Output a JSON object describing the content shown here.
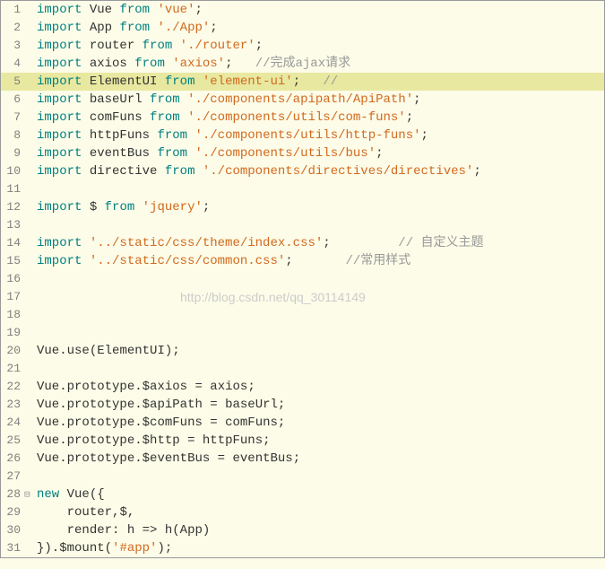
{
  "watermark": "http://blog.csdn.net/qq_30114149",
  "lines": [
    {
      "num": "1",
      "tokens": [
        [
          "kw",
          "import"
        ],
        [
          "",
          " "
        ],
        [
          "id",
          "Vue"
        ],
        [
          "",
          " "
        ],
        [
          "kw",
          "from"
        ],
        [
          "",
          " "
        ],
        [
          "str",
          "'vue'"
        ],
        [
          "",
          ";"
        ]
      ]
    },
    {
      "num": "2",
      "tokens": [
        [
          "kw",
          "import"
        ],
        [
          "",
          " "
        ],
        [
          "id",
          "App"
        ],
        [
          "",
          " "
        ],
        [
          "kw",
          "from"
        ],
        [
          "",
          " "
        ],
        [
          "str",
          "'./App'"
        ],
        [
          "",
          ";"
        ]
      ]
    },
    {
      "num": "3",
      "tokens": [
        [
          "kw",
          "import"
        ],
        [
          "",
          " "
        ],
        [
          "id",
          "router"
        ],
        [
          "",
          " "
        ],
        [
          "kw",
          "from"
        ],
        [
          "",
          " "
        ],
        [
          "str",
          "'./router'"
        ],
        [
          "",
          ";"
        ]
      ]
    },
    {
      "num": "4",
      "tokens": [
        [
          "kw",
          "import"
        ],
        [
          "",
          " "
        ],
        [
          "id",
          "axios"
        ],
        [
          "",
          " "
        ],
        [
          "kw",
          "from"
        ],
        [
          "",
          " "
        ],
        [
          "str",
          "'axios'"
        ],
        [
          "",
          ";   "
        ],
        [
          "cm",
          "//完成ajax请求"
        ]
      ]
    },
    {
      "num": "5",
      "highlighted": true,
      "tokens": [
        [
          "kw",
          "import"
        ],
        [
          "",
          " "
        ],
        [
          "id",
          "ElementUI"
        ],
        [
          "",
          " "
        ],
        [
          "kw",
          "from"
        ],
        [
          "",
          " "
        ],
        [
          "str",
          "'element-ui'"
        ],
        [
          "",
          ";   "
        ],
        [
          "cm",
          "//"
        ]
      ]
    },
    {
      "num": "6",
      "tokens": [
        [
          "kw",
          "import"
        ],
        [
          "",
          " "
        ],
        [
          "id",
          "baseUrl"
        ],
        [
          "",
          " "
        ],
        [
          "kw",
          "from"
        ],
        [
          "",
          " "
        ],
        [
          "str",
          "'./components/apipath/ApiPath'"
        ],
        [
          "",
          ";"
        ]
      ]
    },
    {
      "num": "7",
      "tokens": [
        [
          "kw",
          "import"
        ],
        [
          "",
          " "
        ],
        [
          "id",
          "comFuns"
        ],
        [
          "",
          " "
        ],
        [
          "kw",
          "from"
        ],
        [
          "",
          " "
        ],
        [
          "str",
          "'./components/utils/com-funs'"
        ],
        [
          "",
          ";"
        ]
      ]
    },
    {
      "num": "8",
      "tokens": [
        [
          "kw",
          "import"
        ],
        [
          "",
          " "
        ],
        [
          "id",
          "httpFuns"
        ],
        [
          "",
          " "
        ],
        [
          "kw",
          "from"
        ],
        [
          "",
          " "
        ],
        [
          "str",
          "'./components/utils/http-funs'"
        ],
        [
          "",
          ";"
        ]
      ]
    },
    {
      "num": "9",
      "tokens": [
        [
          "kw",
          "import"
        ],
        [
          "",
          " "
        ],
        [
          "id",
          "eventBus"
        ],
        [
          "",
          " "
        ],
        [
          "kw",
          "from"
        ],
        [
          "",
          " "
        ],
        [
          "str",
          "'./components/utils/bus'"
        ],
        [
          "",
          ";"
        ]
      ]
    },
    {
      "num": "10",
      "tokens": [
        [
          "kw",
          "import"
        ],
        [
          "",
          " "
        ],
        [
          "id",
          "directive"
        ],
        [
          "",
          " "
        ],
        [
          "kw",
          "from"
        ],
        [
          "",
          " "
        ],
        [
          "str",
          "'./components/directives/directives'"
        ],
        [
          "",
          ";"
        ]
      ]
    },
    {
      "num": "11",
      "tokens": []
    },
    {
      "num": "12",
      "tokens": [
        [
          "kw",
          "import"
        ],
        [
          "",
          " "
        ],
        [
          "id",
          "$"
        ],
        [
          "",
          " "
        ],
        [
          "kw",
          "from"
        ],
        [
          "",
          " "
        ],
        [
          "str",
          "'jquery'"
        ],
        [
          "",
          ";"
        ]
      ]
    },
    {
      "num": "13",
      "tokens": []
    },
    {
      "num": "14",
      "tokens": [
        [
          "kw",
          "import"
        ],
        [
          "",
          " "
        ],
        [
          "str",
          "'../static/css/theme/index.css'"
        ],
        [
          "",
          ";         "
        ],
        [
          "cm",
          "// 自定义主题"
        ]
      ]
    },
    {
      "num": "15",
      "tokens": [
        [
          "kw",
          "import"
        ],
        [
          "",
          " "
        ],
        [
          "str",
          "'../static/css/common.css'"
        ],
        [
          "",
          ";       "
        ],
        [
          "cm",
          "//常用样式"
        ]
      ]
    },
    {
      "num": "16",
      "tokens": []
    },
    {
      "num": "17",
      "tokens": [],
      "watermark": true
    },
    {
      "num": "18",
      "tokens": []
    },
    {
      "num": "19",
      "tokens": []
    },
    {
      "num": "20",
      "tokens": [
        [
          "id",
          "Vue"
        ],
        [
          "",
          "."
        ],
        [
          "id",
          "use"
        ],
        [
          "",
          "("
        ],
        [
          "id",
          "ElementUI"
        ],
        [
          "",
          ");"
        ]
      ]
    },
    {
      "num": "21",
      "tokens": []
    },
    {
      "num": "22",
      "tokens": [
        [
          "id",
          "Vue"
        ],
        [
          "",
          "."
        ],
        [
          "id",
          "prototype"
        ],
        [
          "",
          "."
        ],
        [
          "id",
          "$axios"
        ],
        [
          "",
          " = "
        ],
        [
          "id",
          "axios"
        ],
        [
          "",
          ";"
        ]
      ]
    },
    {
      "num": "23",
      "tokens": [
        [
          "id",
          "Vue"
        ],
        [
          "",
          "."
        ],
        [
          "id",
          "prototype"
        ],
        [
          "",
          "."
        ],
        [
          "id",
          "$apiPath"
        ],
        [
          "",
          " = "
        ],
        [
          "id",
          "baseUrl"
        ],
        [
          "",
          ";"
        ]
      ]
    },
    {
      "num": "24",
      "tokens": [
        [
          "id",
          "Vue"
        ],
        [
          "",
          "."
        ],
        [
          "id",
          "prototype"
        ],
        [
          "",
          "."
        ],
        [
          "id",
          "$comFuns"
        ],
        [
          "",
          " = "
        ],
        [
          "id",
          "comFuns"
        ],
        [
          "",
          ";"
        ]
      ]
    },
    {
      "num": "25",
      "tokens": [
        [
          "id",
          "Vue"
        ],
        [
          "",
          "."
        ],
        [
          "id",
          "prototype"
        ],
        [
          "",
          "."
        ],
        [
          "id",
          "$http"
        ],
        [
          "",
          " = "
        ],
        [
          "id",
          "httpFuns"
        ],
        [
          "",
          ";"
        ]
      ]
    },
    {
      "num": "26",
      "tokens": [
        [
          "id",
          "Vue"
        ],
        [
          "",
          "."
        ],
        [
          "id",
          "prototype"
        ],
        [
          "",
          "."
        ],
        [
          "id",
          "$eventBus"
        ],
        [
          "",
          " = "
        ],
        [
          "id",
          "eventBus"
        ],
        [
          "",
          ";"
        ]
      ]
    },
    {
      "num": "27",
      "tokens": []
    },
    {
      "num": "28",
      "fold": true,
      "tokens": [
        [
          "kw",
          "new"
        ],
        [
          "",
          " "
        ],
        [
          "id",
          "Vue"
        ],
        [
          "",
          "({"
        ]
      ]
    },
    {
      "num": "29",
      "tokens": [
        [
          "",
          "    "
        ],
        [
          "id",
          "router"
        ],
        [
          "",
          ","
        ],
        [
          "id",
          "$"
        ],
        [
          "",
          ","
        ]
      ]
    },
    {
      "num": "30",
      "tokens": [
        [
          "",
          "    "
        ],
        [
          "id",
          "render"
        ],
        [
          "",
          ": "
        ],
        [
          "id",
          "h"
        ],
        [
          "",
          " => "
        ],
        [
          "id",
          "h"
        ],
        [
          "",
          "("
        ],
        [
          "id",
          "App"
        ],
        [
          "",
          ")"
        ]
      ]
    },
    {
      "num": "31",
      "tokens": [
        [
          "",
          "})."
        ],
        [
          "id",
          "$mount"
        ],
        [
          "",
          "("
        ],
        [
          "str",
          "'#app'"
        ],
        [
          "",
          ");"
        ]
      ]
    }
  ]
}
